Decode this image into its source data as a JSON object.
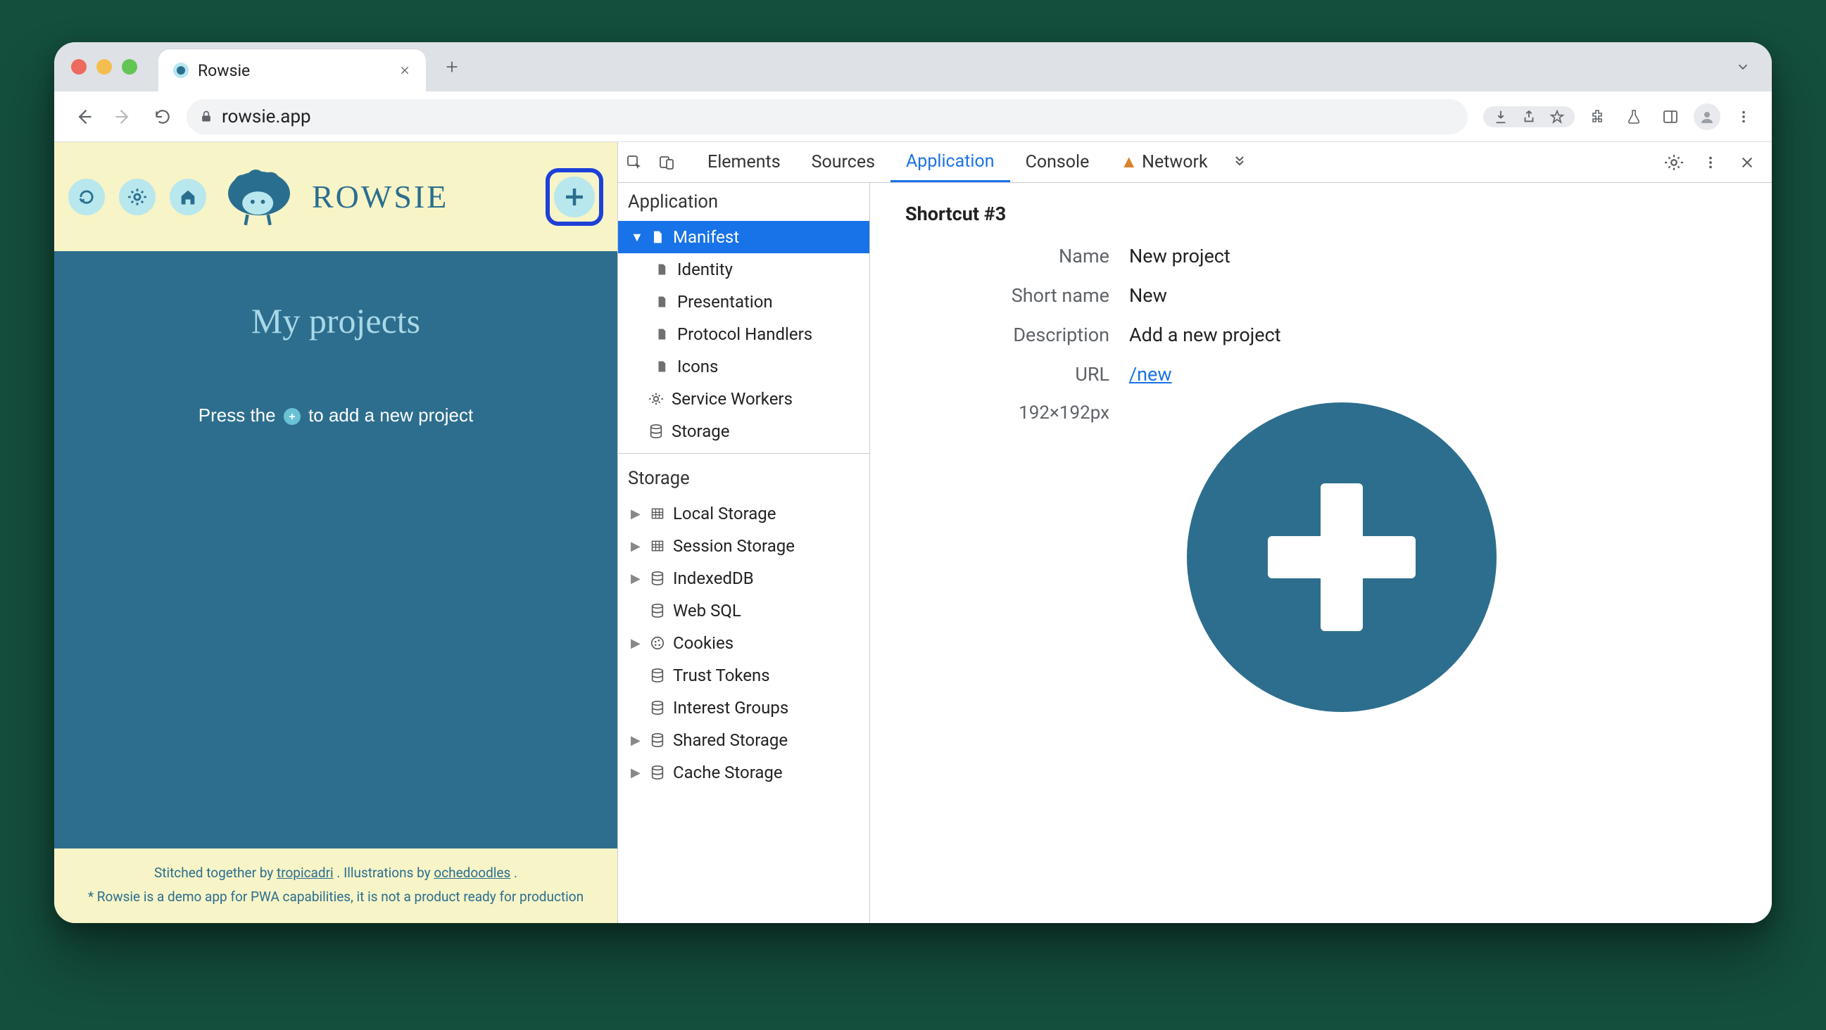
{
  "browser": {
    "tab_title": "Rowsie",
    "url": "rowsie.app"
  },
  "app": {
    "wordmark": "ROWSIE",
    "heading": "My projects",
    "prompt_before": "Press the ",
    "prompt_after": " to add a new project",
    "footer_line_pre": "Stitched together by ",
    "footer_link1": "tropicadri",
    "footer_mid": ". Illustrations by ",
    "footer_link2": "ochedoodles",
    "footer_post": ".",
    "footer_disclaimer": "* Rowsie is a demo app for PWA capabilities, it is not a product ready for production"
  },
  "devtools": {
    "tabs": {
      "elements": "Elements",
      "sources": "Sources",
      "application": "Application",
      "console": "Console",
      "network": "Network"
    },
    "tree": {
      "app_header": "Application",
      "manifest": "Manifest",
      "identity": "Identity",
      "presentation": "Presentation",
      "protocol": "Protocol Handlers",
      "icons": "Icons",
      "sw": "Service Workers",
      "storage_node": "Storage",
      "storage_header": "Storage",
      "local": "Local Storage",
      "session": "Session Storage",
      "idb": "IndexedDB",
      "websql": "Web SQL",
      "cookies": "Cookies",
      "trust": "Trust Tokens",
      "interest": "Interest Groups",
      "shared": "Shared Storage",
      "cache": "Cache Storage"
    },
    "detail": {
      "title": "Shortcut #3",
      "name_label": "Name",
      "name_value": "New project",
      "short_label": "Short name",
      "short_value": "New",
      "desc_label": "Description",
      "desc_value": "Add a new project",
      "url_label": "URL",
      "url_value": "/new",
      "dim": "192×192px"
    }
  }
}
